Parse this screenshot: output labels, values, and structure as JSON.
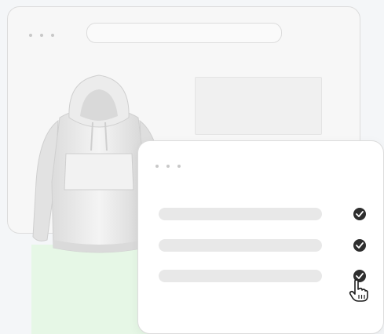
{
  "back_window": {
    "dots": 3,
    "address_bar": {
      "value": ""
    }
  },
  "product": {
    "icon": "hoodie-image"
  },
  "front_window": {
    "dots": 3,
    "checklist": [
      {
        "label": "",
        "checked": true
      },
      {
        "label": "",
        "checked": true
      },
      {
        "label": "",
        "checked": true
      }
    ]
  },
  "cursor": {
    "icon": "hand-pointer-icon"
  },
  "colors": {
    "accent_green": "#e6f7e6",
    "check_fill": "#2e2e2e",
    "window_border": "#dcdcdc"
  }
}
